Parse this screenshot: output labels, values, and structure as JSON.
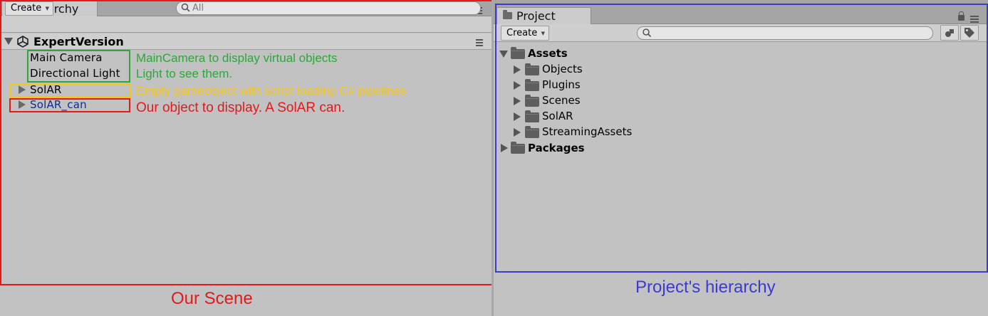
{
  "hierarchy": {
    "tab_label": "Hierarchy",
    "create_label": "Create",
    "search_placeholder": "All",
    "scene_name": "ExpertVersion",
    "items": [
      {
        "label": "Main Camera",
        "color": "#000000"
      },
      {
        "label": "Directional Light",
        "color": "#000000"
      },
      {
        "label": "SolAR",
        "color": "#000000"
      },
      {
        "label": "SolAR_can",
        "color": "#0e2b9c"
      }
    ]
  },
  "annotations": {
    "camera_light_line1": "MainCamera to display virtual objects",
    "camera_light_line2": "Light to see them.",
    "solar": "Empty gameobject with script loading C# pipelines",
    "solar_can": "Our object to display. A SolAR can.",
    "scene_caption": "Our Scene",
    "project_caption": "Project's hierarchy",
    "colors": {
      "green": "#2aa83a",
      "yellow": "#f5c518",
      "red": "#e01b1b",
      "blue": "#3b3bd1"
    }
  },
  "project": {
    "tab_label": "Project",
    "create_label": "Create",
    "search_placeholder": "",
    "tree": [
      {
        "label": "Assets",
        "expanded": true,
        "bold": true
      },
      {
        "label": "Objects"
      },
      {
        "label": "Plugins"
      },
      {
        "label": "Scenes"
      },
      {
        "label": "SolAR"
      },
      {
        "label": "StreamingAssets"
      },
      {
        "label": "Packages",
        "expanded": false,
        "bold": true
      }
    ]
  }
}
